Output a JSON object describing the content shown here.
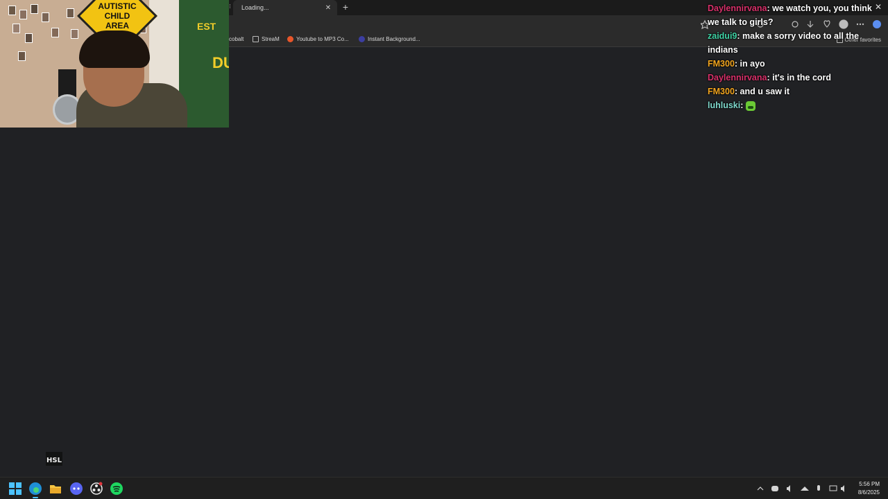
{
  "browser": {
    "tab_title": "Loading...",
    "tab_close": "✕",
    "new_tab": "+",
    "tab_menu": "⁝",
    "bookmarks": [
      "cobalt",
      "StreaM",
      "Youtube to MP3 Co...",
      "Instant Background..."
    ],
    "other_favorites": "Other favorites"
  },
  "webcam": {
    "sign_text": "AUTISTIC CHILD AREA",
    "blanket_text": "EST",
    "blanket_text2": "DUC"
  },
  "chat": {
    "messages": [
      {
        "user": "Daylennirvana",
        "color": "#d9306a",
        "text": "we watch you, you think we talk to girls?"
      },
      {
        "user": "zaidui9",
        "color": "#3fd3a5",
        "text": "make a sorry video to all the indians"
      },
      {
        "user": "FM300",
        "color": "#f2a51e",
        "text": "in ayo"
      },
      {
        "user": "Daylennirvana",
        "color": "#d9306a",
        "text": "it's in the cord"
      },
      {
        "user": "FM300",
        "color": "#f2a51e",
        "text": "and u saw it"
      },
      {
        "user": "luhluski",
        "color": "#7fd9cd",
        "text": ""
      }
    ],
    "close": "✕"
  },
  "taskbar": {
    "time": "5:56 PM",
    "date": "8/6/2025",
    "apps": [
      "start-icon",
      "edge-icon",
      "file-explorer-icon",
      "discord-icon",
      "obs-icon",
      "spotify-icon"
    ]
  },
  "watermark_text": "HSL"
}
